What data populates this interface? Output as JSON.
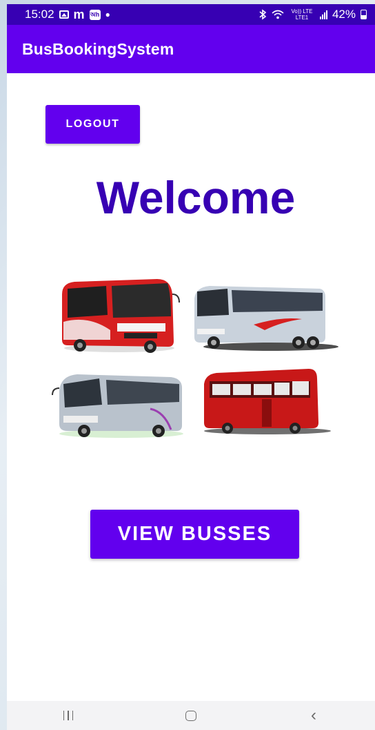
{
  "status_bar": {
    "time": "15:02",
    "network": "Vo)) LTE LTE1",
    "battery_percent": "42%",
    "battery_level": 0.42,
    "icons": [
      "gallery-icon",
      "m-icon",
      "app-badge-icon",
      "dot-icon",
      "bluetooth-icon",
      "wifi-icon",
      "signal-icon",
      "battery-icon"
    ],
    "m_glyph": "m",
    "badge_glyph": "অh"
  },
  "app_bar": {
    "title": "BusBookingSystem"
  },
  "main": {
    "logout_label": "LOGOUT",
    "welcome_text": "Welcome",
    "view_busses_label": "VIEW BUSSES"
  },
  "nav_bar": {
    "icons": [
      "recents-icon",
      "home-icon",
      "back-icon"
    ]
  },
  "colors": {
    "primary": "#6200ee",
    "primary_dark": "#3700b3",
    "bus_red": "#d62020",
    "bus_silver": "#c9d2dc"
  }
}
